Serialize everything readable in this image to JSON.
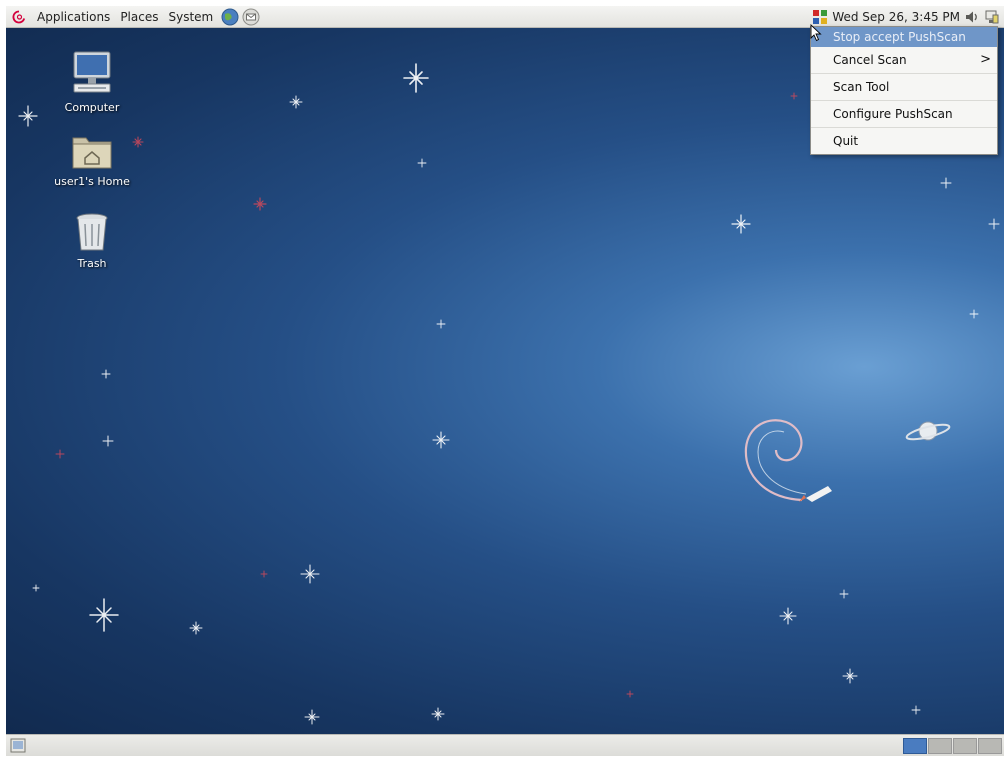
{
  "top_panel": {
    "menus": {
      "applications": "Applications",
      "places": "Places",
      "system": "System"
    },
    "clock": "Wed Sep 26,  3:45 PM"
  },
  "desktop_icons": [
    {
      "label": "Computer",
      "icon": "computer-icon"
    },
    {
      "label": "user1's Home",
      "icon": "home-folder-icon"
    },
    {
      "label": "Trash",
      "icon": "trash-icon"
    }
  ],
  "popup_menu": {
    "items": [
      {
        "label": "Stop accept PushScan",
        "highlighted": true
      },
      {
        "label": "Cancel Scan",
        "submenu": true,
        "arrow": ">"
      },
      {
        "label": "Scan Tool"
      },
      {
        "label": "Configure PushScan"
      },
      {
        "label": "Quit"
      }
    ]
  },
  "colors": {
    "menu_highlight": "#6f96c8",
    "desktop_blue": "#254f86",
    "workspace_active": "#4a7cc0"
  },
  "bottom_panel": {
    "workspace_count": 4,
    "active_workspace": 1
  }
}
